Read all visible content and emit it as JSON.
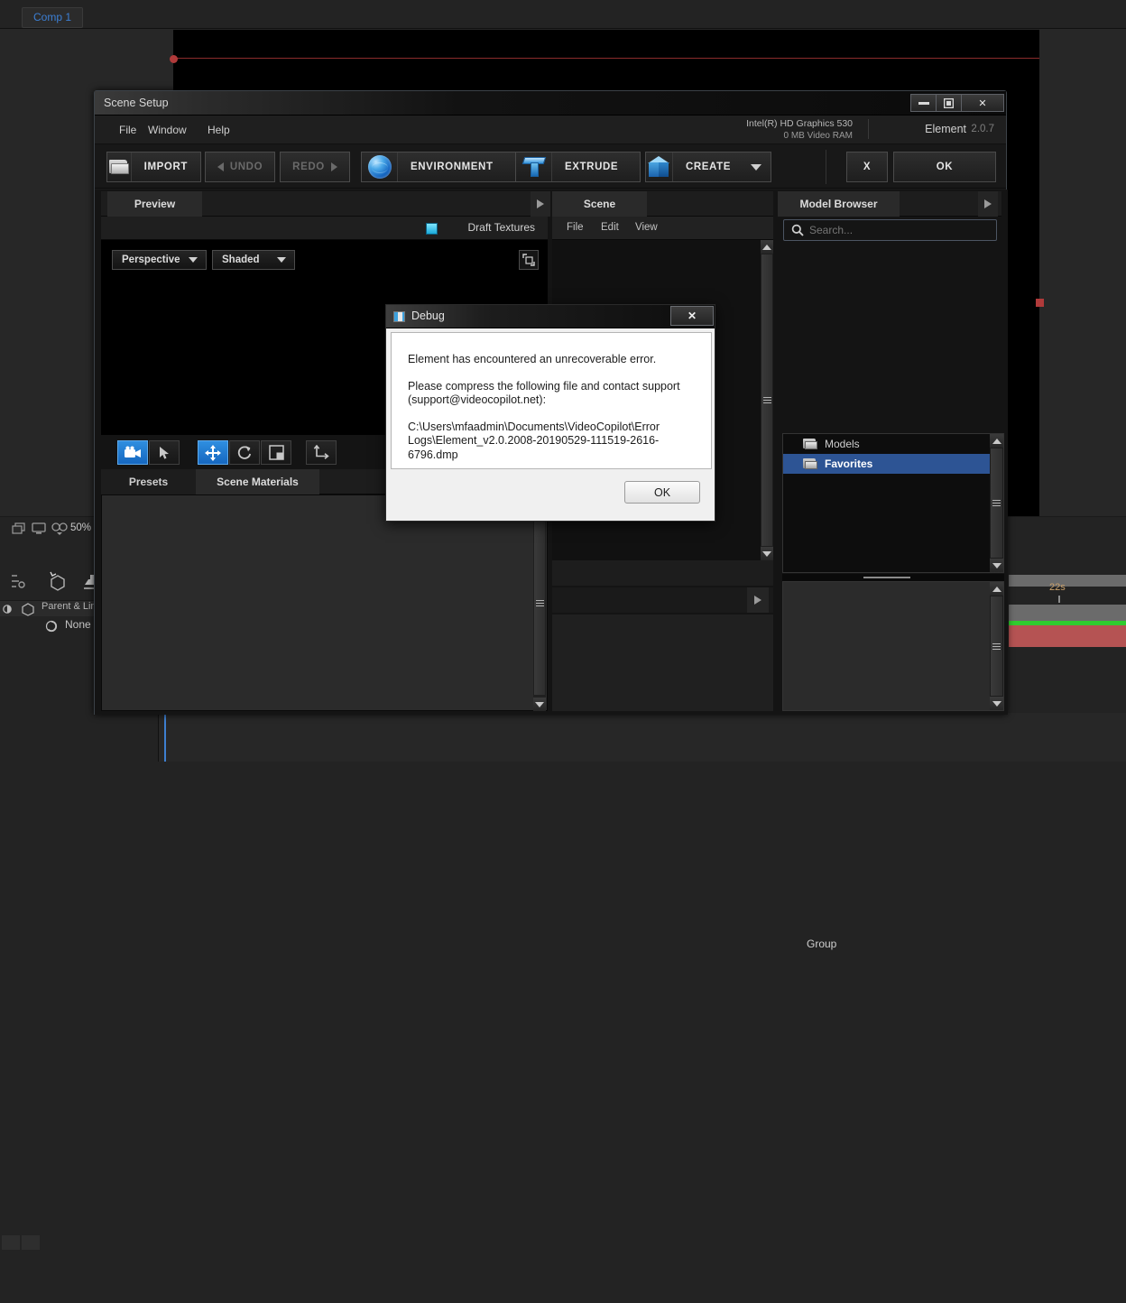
{
  "ae": {
    "comp_tab_label": "Comp 1",
    "zoom_level": "50%",
    "parent_column_label": "Parent & Link",
    "parent_value": "None",
    "timeline_time_marker": "22s",
    "icons": {
      "layers": "layers-icon",
      "monitor": "monitor-icon",
      "mask_view": "mask-view-icon",
      "snapshot": "snapshot-icon",
      "threed_layer": "3d-layer-icon",
      "light": "light-icon",
      "camera": "camera-icon",
      "footage": "footage-icon",
      "shy": "shy-icon",
      "collapse": "collapse-transform-icon",
      "parent_pick": "parent-pickwhip-icon"
    }
  },
  "element": {
    "window_title": "Scene Setup",
    "window_controls": {
      "minimize": "–",
      "maximize": "□",
      "close": "✕"
    },
    "menus": [
      "File",
      "Window",
      "Help"
    ],
    "gpu_name": "Intel(R) HD Graphics 530",
    "gpu_vram": "0 MB Video RAM",
    "brand": "Element",
    "version": "2.0.7",
    "toolbar": {
      "import": "IMPORT",
      "undo": "UNDO",
      "redo": "REDO",
      "environment": "ENVIRONMENT",
      "extrude": "EXTRUDE",
      "create": "CREATE",
      "cancel": "X",
      "ok": "OK"
    },
    "preview": {
      "tab": "Preview",
      "draft_textures_label": "Draft Textures",
      "draft_textures_checked": true,
      "view_mode": "Perspective",
      "shading_mode": "Shaded",
      "tools": [
        {
          "name": "camera-tool",
          "active": true
        },
        {
          "name": "select-tool",
          "active": false
        },
        {
          "name": "move-tool",
          "active": true
        },
        {
          "name": "rotate-tool",
          "active": false
        },
        {
          "name": "scale-tool",
          "active": false
        },
        {
          "name": "axis-tool",
          "active": false
        }
      ]
    },
    "presets_panel": {
      "tabs": [
        {
          "label": "Presets",
          "active": false
        },
        {
          "label": "Scene Materials",
          "active": true
        }
      ]
    },
    "scene_panel": {
      "tab": "Scene",
      "menus": [
        "File",
        "Edit",
        "View"
      ],
      "group_label": "Group"
    },
    "model_browser": {
      "tab": "Model Browser",
      "search_placeholder": "Search...",
      "search_value": "",
      "items": [
        {
          "label": "Models",
          "selected": false
        },
        {
          "label": "Favorites",
          "selected": true
        }
      ]
    },
    "colors": {
      "accent_blue": "#2f8fe0",
      "selection_blue": "#2d5494",
      "panel_bg": "#1b1b1b",
      "toolbar_bg": "#181818"
    }
  },
  "debug_dialog": {
    "title": "Debug",
    "close_label": "✕",
    "line1": "Element has encountered an unrecoverable error.",
    "line2": "Please compress the following file and contact support (support@videocopilot.net):",
    "line3": "C:\\Users\\mfaadmin\\Documents\\VideoCopilot\\Error Logs\\Element_v2.0.2008-20190529-111519-2616-6796.dmp",
    "ok_label": "OK"
  }
}
